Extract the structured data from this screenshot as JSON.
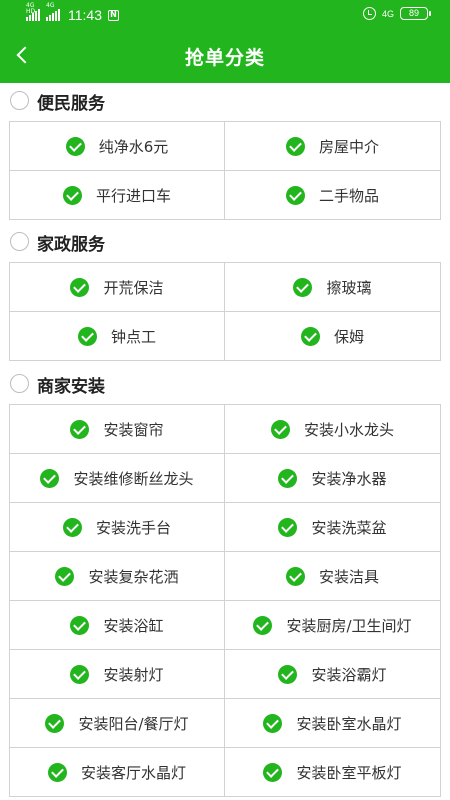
{
  "status_bar": {
    "time": "11:43",
    "signal1": "4G HD",
    "signal2": "4G",
    "network": "4G",
    "battery": "89",
    "icons": [
      "signal-icon",
      "signal-icon",
      "nfc-icon",
      "alarm-icon",
      "network-4g-icon",
      "battery-icon"
    ]
  },
  "header": {
    "title": "抢单分类",
    "back_icon": "chevron-left-icon",
    "background": "#22b51d"
  },
  "colors": {
    "accent": "#22b51d",
    "border": "#d2d2d2",
    "text": "#333333"
  },
  "sections": [
    {
      "label": "便民服务",
      "items": [
        "纯净水6元",
        "房屋中介",
        "平行进口车",
        "二手物品"
      ]
    },
    {
      "label": "家政服务",
      "items": [
        "开荒保洁",
        "擦玻璃",
        "钟点工",
        "保姆"
      ]
    },
    {
      "label": "商家安装",
      "items": [
        "安装窗帘",
        "安装小水龙头",
        "安装维修断丝龙头",
        "安装净水器",
        "安装洗手台",
        "安装洗菜盆",
        "安装复杂花洒",
        "安装洁具",
        "安装浴缸",
        "安装厨房/卫生间灯",
        "安装射灯",
        "安装浴霸灯",
        "安装阳台/餐厅灯",
        "安装卧室水晶灯",
        "安装客厅水晶灯",
        "安装卧室平板灯"
      ]
    }
  ]
}
